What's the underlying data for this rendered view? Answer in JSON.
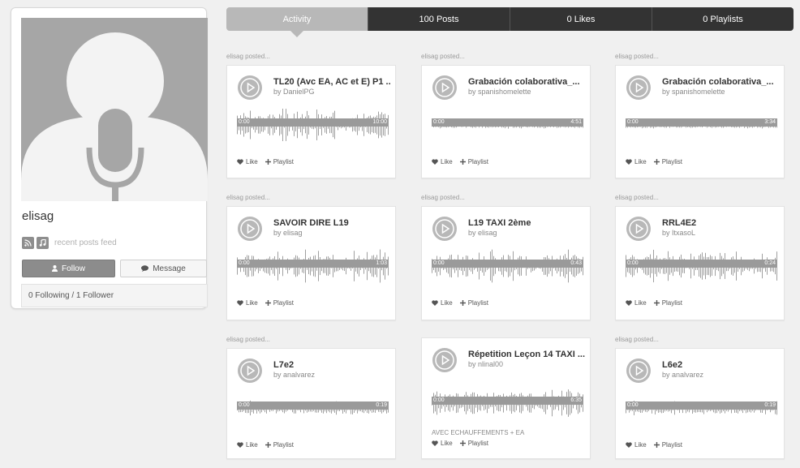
{
  "profile": {
    "username": "elisag",
    "feed_label": "recent posts feed",
    "follow_label": "Follow",
    "message_label": "Message",
    "follow_stats": "0 Following / 1 Follower"
  },
  "tabs": [
    {
      "label": "Activity",
      "active": true
    },
    {
      "label": "100 Posts"
    },
    {
      "label": "0 Likes"
    },
    {
      "label": "0 Playlists"
    }
  ],
  "posts": [
    {
      "posted": "elisag posted...",
      "title": "TL20 (Avc EA, AC et E) P1 ...",
      "author": "by DanielPG",
      "start": "0:00",
      "end": "10:00",
      "description": "",
      "like": "Like",
      "playlist": "Playlist"
    },
    {
      "posted": "elisag posted...",
      "title": "Grabación colaborativa_...",
      "author": "by spanishomelette",
      "start": "0:00",
      "end": "4:51",
      "description": "",
      "like": "Like",
      "playlist": "Playlist"
    },
    {
      "posted": "elisag posted...",
      "title": "Grabación colaborativa_...",
      "author": "by spanishomelette",
      "start": "0:00",
      "end": "3:34",
      "description": "",
      "like": "Like",
      "playlist": "Playlist"
    },
    {
      "posted": "elisag posted...",
      "title": "SAVOIR DIRE L19",
      "author": "by elisag",
      "start": "0:00",
      "end": "1:03",
      "description": "",
      "like": "Like",
      "playlist": "Playlist"
    },
    {
      "posted": "elisag posted...",
      "title": "L19 TAXI 2ème",
      "author": "by elisag",
      "start": "0:00",
      "end": "0:43",
      "description": "",
      "like": "Like",
      "playlist": "Playlist"
    },
    {
      "posted": "elisag posted...",
      "title": "RRL4E2",
      "author": "by ItxasoL",
      "start": "0:00",
      "end": "0:24",
      "description": "",
      "like": "Like",
      "playlist": "Playlist"
    },
    {
      "posted": "elisag posted...",
      "title": "L7e2",
      "author": "by analvarez",
      "start": "0:00",
      "end": "0:19",
      "description": "",
      "like": "Like",
      "playlist": "Playlist"
    },
    {
      "posted": "",
      "title": "Répetition Leçon 14 TAXI ...",
      "author": "by nlinal00",
      "start": "0:00",
      "end": "6:35",
      "description": "AVEC ECHAUFFEMENTS + EA",
      "like": "Like",
      "playlist": "Playlist"
    },
    {
      "posted": "elisag posted...",
      "title": "L6e2",
      "author": "by analvarez",
      "start": "0:00",
      "end": "0:19",
      "description": "",
      "like": "Like",
      "playlist": "Playlist"
    }
  ],
  "icons": {
    "play": "play-icon",
    "heart": "heart-icon",
    "plus": "plus-icon",
    "user": "user-icon",
    "chat": "chat-icon",
    "rss": "rss-icon",
    "music": "music-icon"
  },
  "colors": {
    "tab_active": "#b8b8b8",
    "tab_inactive": "#333333",
    "waveform": "#a0a0a0",
    "avatar_bg": "#a6a6a6"
  }
}
